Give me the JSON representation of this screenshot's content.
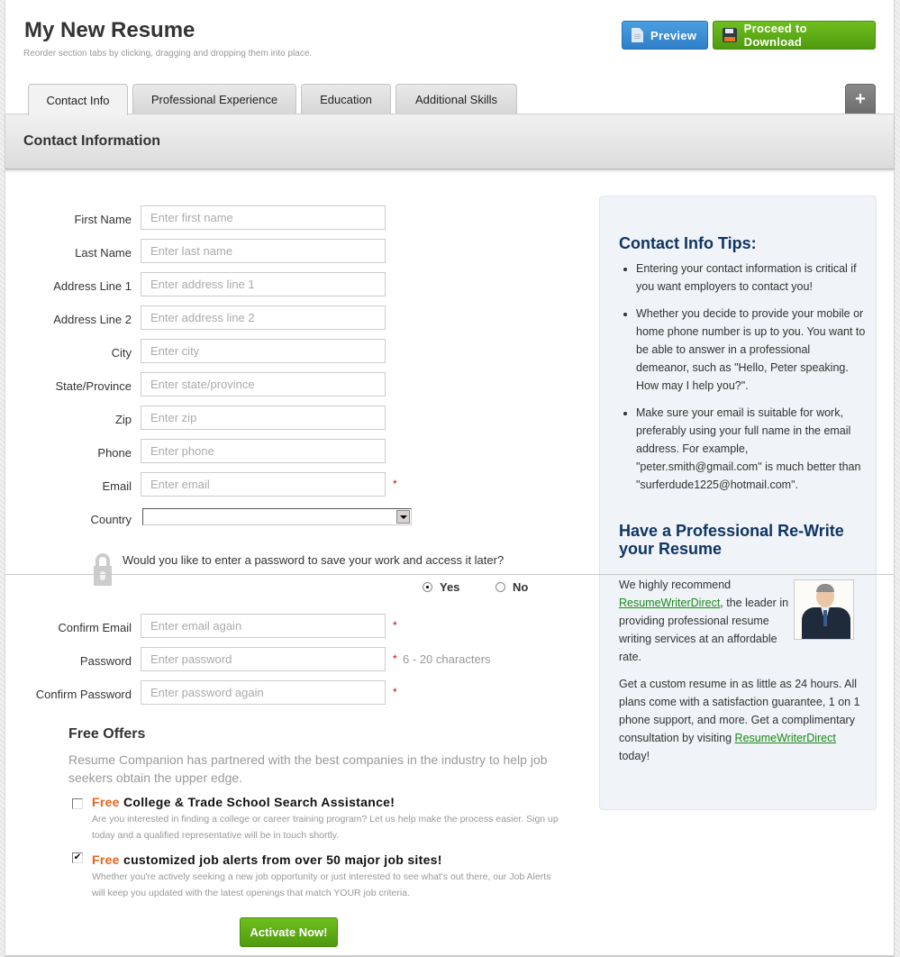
{
  "header": {
    "title": "My New Resume",
    "subtitle": "Reorder section tabs by clicking, dragging and dropping them into place.",
    "preview_label": "Preview",
    "download_label": "Proceed to Download"
  },
  "tabs": [
    {
      "label": "Contact Info",
      "active": true
    },
    {
      "label": "Professional Experience",
      "active": false
    },
    {
      "label": "Education",
      "active": false
    },
    {
      "label": "Additional Skills",
      "active": false
    }
  ],
  "add_tab_label": "+",
  "section": {
    "title": "Contact Information"
  },
  "form": {
    "fields": [
      {
        "label": "First Name",
        "placeholder": "Enter first name",
        "value": "",
        "required": false
      },
      {
        "label": "Last Name",
        "placeholder": "Enter last name",
        "value": "",
        "required": false
      },
      {
        "label": "Address Line 1",
        "placeholder": "Enter address line 1",
        "value": "",
        "required": false
      },
      {
        "label": "Address Line 2",
        "placeholder": "Enter address line 2",
        "value": "",
        "required": false
      },
      {
        "label": "City",
        "placeholder": "Enter city",
        "value": "",
        "required": false
      },
      {
        "label": "State/Province",
        "placeholder": "Enter state/province",
        "value": "",
        "required": false
      },
      {
        "label": "Zip",
        "placeholder": "Enter zip",
        "value": "",
        "required": false
      },
      {
        "label": "Phone",
        "placeholder": "Enter phone",
        "value": "",
        "required": false
      },
      {
        "label": "Email",
        "placeholder": "Enter email",
        "value": "",
        "required": true
      }
    ],
    "country": {
      "label": "Country",
      "selected": ""
    },
    "required_mark": "*",
    "password_question": "Would you like to enter a password to save your work and access it later?",
    "password_options": [
      {
        "label": "Yes",
        "checked": true
      },
      {
        "label": "No",
        "checked": false
      }
    ],
    "password_fields": [
      {
        "label": "Confirm Email",
        "placeholder": "Enter email again",
        "value": "",
        "hint": ""
      },
      {
        "label": "Password",
        "placeholder": "Enter password",
        "value": "",
        "hint": "6 - 20 characters"
      },
      {
        "label": "Confirm Password",
        "placeholder": "Enter password again",
        "value": "",
        "hint": ""
      }
    ]
  },
  "offers": {
    "title": "Free Offers",
    "intro": "Resume Companion has partnered with the best companies in the industry to help job seekers obtain the upper edge.",
    "items": [
      {
        "free_word": "Free",
        "title": "College & Trade School Search Assistance!",
        "description": "Are you interested in finding a college or career training program? Let us help make the process easier. Sign up today and a qualified representative will be in touch shortly.",
        "checked": false
      },
      {
        "free_word": "Free",
        "title": "customized job alerts from over 50 major job sites!",
        "description": "Whether you're actively seeking a new job opportunity or just interested to see what's out there, our Job Alerts will keep you updated with the latest openings that match YOUR job criteria.",
        "checked": true
      }
    ],
    "activate_label": "Activate Now!"
  },
  "tips": {
    "title": "Contact Info Tips:",
    "items": [
      "Entering your contact information is critical if you want employers to contact you!",
      "Whether you decide to provide your mobile or home phone number is up to you. You want to be able to answer in a professional demeanor, such as \"Hello, Peter speaking. How may I help you?\".",
      "Make sure your email is suitable for work, preferably using your full name in the email address. For example, \"peter.smith@gmail.com\" is much better than \"surferdude1225@hotmail.com\"."
    ],
    "promo_title": "Have a Professional Re-Write your Resume",
    "promo_p1_before": "We highly recommend ",
    "promo_link": "ResumeWriterDirect",
    "promo_p1_after": ", the leader in providing professional resume writing services at an affordable rate.",
    "promo_p2_before": "Get a custom resume in as little as 24 hours. All plans come with a satisfaction guarantee, 1 on 1 phone support, and more. Get a complimentary consultation by visiting ",
    "promo_p2_after": " today!"
  },
  "colors": {
    "preview_blue": "#2f7fc8",
    "download_green": "#5aa814",
    "free_orange": "#e8641c",
    "tips_heading": "#0f3562",
    "link_green": "#1a8a1a",
    "required_red": "#cc0000"
  }
}
